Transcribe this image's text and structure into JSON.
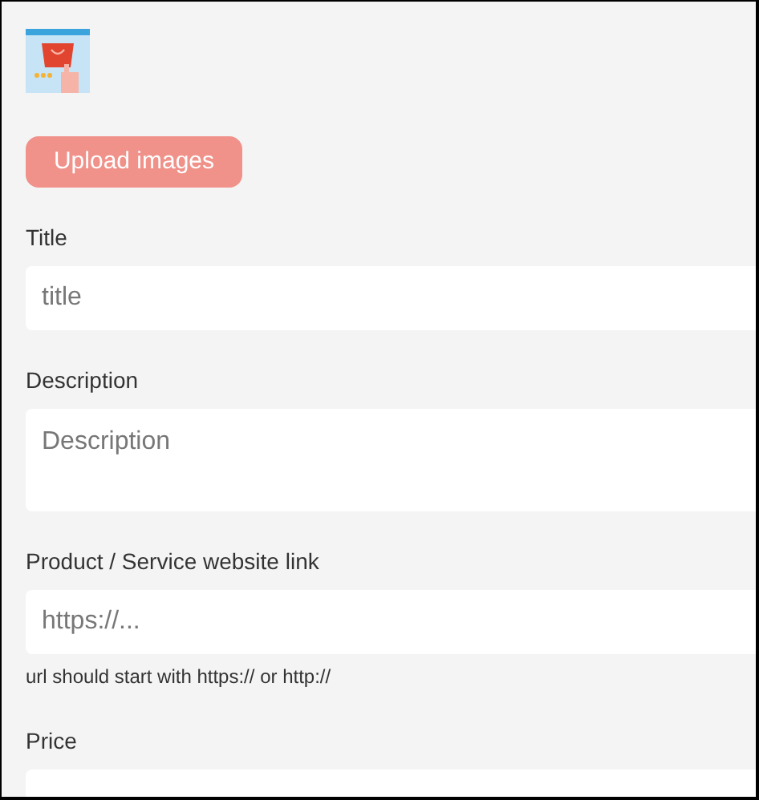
{
  "upload_button": {
    "label": "Upload images"
  },
  "fields": [
    {
      "kind": "input",
      "label": "Title",
      "placeholder": "title"
    },
    {
      "kind": "textarea",
      "label": "Description",
      "placeholder": "Description"
    },
    {
      "kind": "input",
      "label": "Product / Service website link",
      "placeholder": "https://...",
      "hint": "url should start with https:// or http://"
    },
    {
      "kind": "input",
      "label": "Price"
    }
  ]
}
